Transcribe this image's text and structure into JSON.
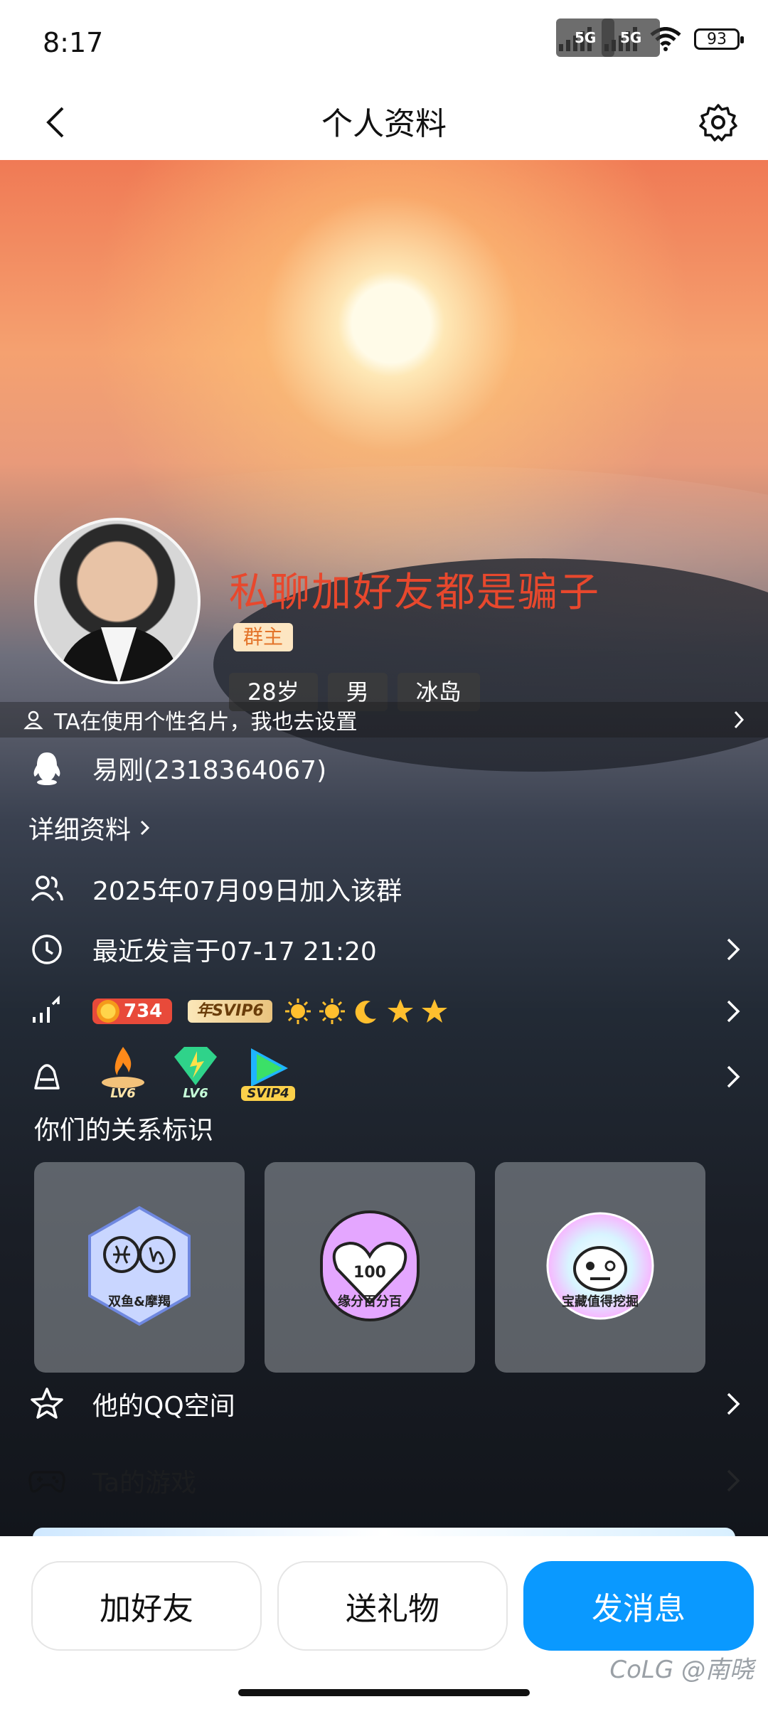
{
  "status_bar": {
    "time": "8:17",
    "net1": "5G",
    "net2": "5G",
    "battery": "93"
  },
  "nav": {
    "title": "个人资料",
    "back_icon": "chevron-left-icon",
    "settings_icon": "gear-icon"
  },
  "profile": {
    "nickname": "私聊加好友都是骗子",
    "role": "群主",
    "tags": [
      "28岁",
      "男",
      "冰岛"
    ],
    "card_hint": "TA在使用个性名片，我也去设置"
  },
  "info": {
    "qq": "易刚(2318364067)",
    "detail_link": "详细资料",
    "join_date": "2025年07月09日加入该群",
    "last_speak": "最近发言于07-17 21:20",
    "coin_value": "734",
    "svip_label": "年SVIP6",
    "level_badges": [
      "LV6",
      "LV6",
      "SVIP4"
    ]
  },
  "relation": {
    "title": "你们的关系标识",
    "cards": [
      "双鱼&摩羯",
      "缘分百分百",
      "宝藏值得挖掘"
    ]
  },
  "rows": {
    "qzone": "他的QQ空间",
    "games": "Ta的游戏"
  },
  "actions": {
    "add_friend": "加好友",
    "send_gift": "送礼物",
    "send_message": "发消息"
  },
  "watermark": "CoLG @南晓",
  "colors": {
    "primary": "#0a99ff",
    "nickname": "#e8482d",
    "role_bg": "#fde6c2",
    "role_fg": "#e3742a"
  }
}
